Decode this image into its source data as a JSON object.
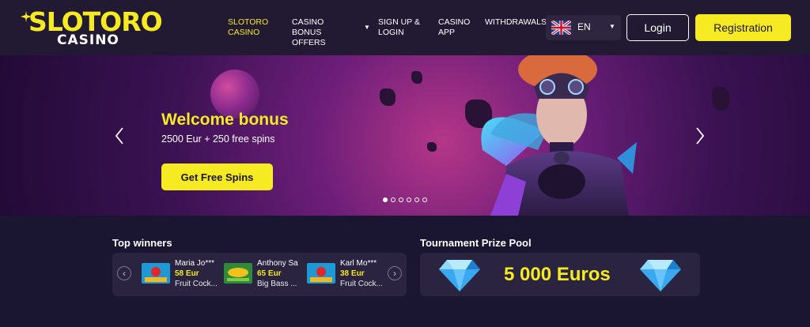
{
  "brand": {
    "main": "SLOTORO",
    "sub": "CASINO"
  },
  "nav": {
    "items": [
      {
        "label": "SLOTORO CASINO",
        "active": true
      },
      {
        "label": "CASINO BONUS OFFERS",
        "active": false,
        "has_dropdown": true
      },
      {
        "label": "SIGN UP & LOGIN",
        "active": false
      },
      {
        "label": "CASINO APP",
        "active": false
      },
      {
        "label": "WITHDRAWALS",
        "active": false
      }
    ],
    "language": {
      "value": "EN",
      "icon": "uk-flag-icon"
    },
    "login_label": "Login",
    "register_label": "Registration"
  },
  "hero": {
    "title": "Welcome bonus",
    "subtitle": "2500 Eur + 250 free spins",
    "cta_label": "Get Free Spins",
    "slide_count": 6,
    "active_slide": 1
  },
  "top_winners": {
    "title": "Top winners",
    "items": [
      {
        "name": "Maria Jo***",
        "amount": "58 Eur",
        "game": "Fruit Cock...",
        "thumb": "fruit-cocktail"
      },
      {
        "name": "Anthony Sa",
        "amount": "65 Eur",
        "game": "Big Bass ...",
        "thumb": "big-bass"
      },
      {
        "name": "Karl Mo***",
        "amount": "38 Eur",
        "game": "Fruit Cock...",
        "thumb": "fruit-cocktail"
      }
    ]
  },
  "tournament": {
    "title": "Tournament Prize Pool",
    "amount": "5 000 Euros"
  },
  "colors": {
    "accent": "#f6ea22",
    "header_bg": "#221a32",
    "page_bg": "#1a1530",
    "card_bg": "#2a2440"
  }
}
